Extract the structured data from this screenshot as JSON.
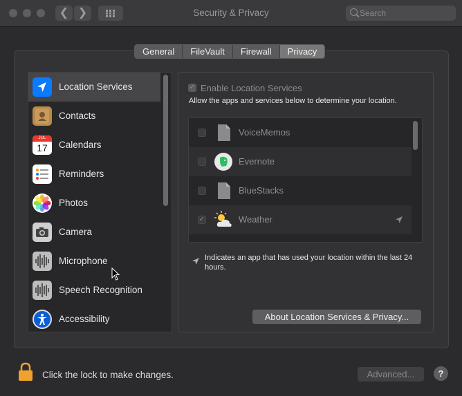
{
  "window": {
    "title": "Security & Privacy"
  },
  "toolbar": {
    "search_placeholder": "Search",
    "back_glyph": "❮",
    "forward_glyph": "❯"
  },
  "tabs": [
    {
      "label": "General",
      "active": false
    },
    {
      "label": "FileVault",
      "active": false
    },
    {
      "label": "Firewall",
      "active": false
    },
    {
      "label": "Privacy",
      "active": true
    }
  ],
  "sidebar": {
    "items": [
      {
        "label": "Location Services",
        "icon": "location-arrow-icon",
        "selected": true
      },
      {
        "label": "Contacts",
        "icon": "contacts-book-icon"
      },
      {
        "label": "Calendars",
        "icon": "calendar-icon",
        "calendar_month": "JUL",
        "calendar_day": "17"
      },
      {
        "label": "Reminders",
        "icon": "reminders-list-icon"
      },
      {
        "label": "Photos",
        "icon": "photos-flower-icon"
      },
      {
        "label": "Camera",
        "icon": "camera-icon"
      },
      {
        "label": "Microphone",
        "icon": "microphone-waveform-icon"
      },
      {
        "label": "Speech Recognition",
        "icon": "speech-waveform-icon"
      },
      {
        "label": "Accessibility",
        "icon": "accessibility-person-icon"
      }
    ]
  },
  "location": {
    "enable_label": "Enable Location Services",
    "enable_checked": true,
    "description": "Allow the apps and services below to determine your location.",
    "apps": [
      {
        "name": "VoiceMemos",
        "checked": false,
        "icon": "generic-document-icon",
        "recent": false
      },
      {
        "name": "Evernote",
        "checked": false,
        "icon": "evernote-elephant-icon",
        "recent": false
      },
      {
        "name": "BlueStacks",
        "checked": false,
        "icon": "generic-document-icon",
        "recent": false
      },
      {
        "name": "Weather",
        "checked": true,
        "icon": "weather-sun-cloud-icon",
        "recent": true
      }
    ],
    "check_glyph": "✓",
    "legend": "Indicates an app that has used your location within the last 24 hours.",
    "about_button": "About Location Services & Privacy..."
  },
  "footer": {
    "lock_text": "Click the lock to make changes.",
    "advanced_button": "Advanced...",
    "help_button": "?"
  },
  "colors": {
    "accent": "#0a7aff",
    "lock": "#f0a230",
    "background": "#2b2b2d"
  }
}
